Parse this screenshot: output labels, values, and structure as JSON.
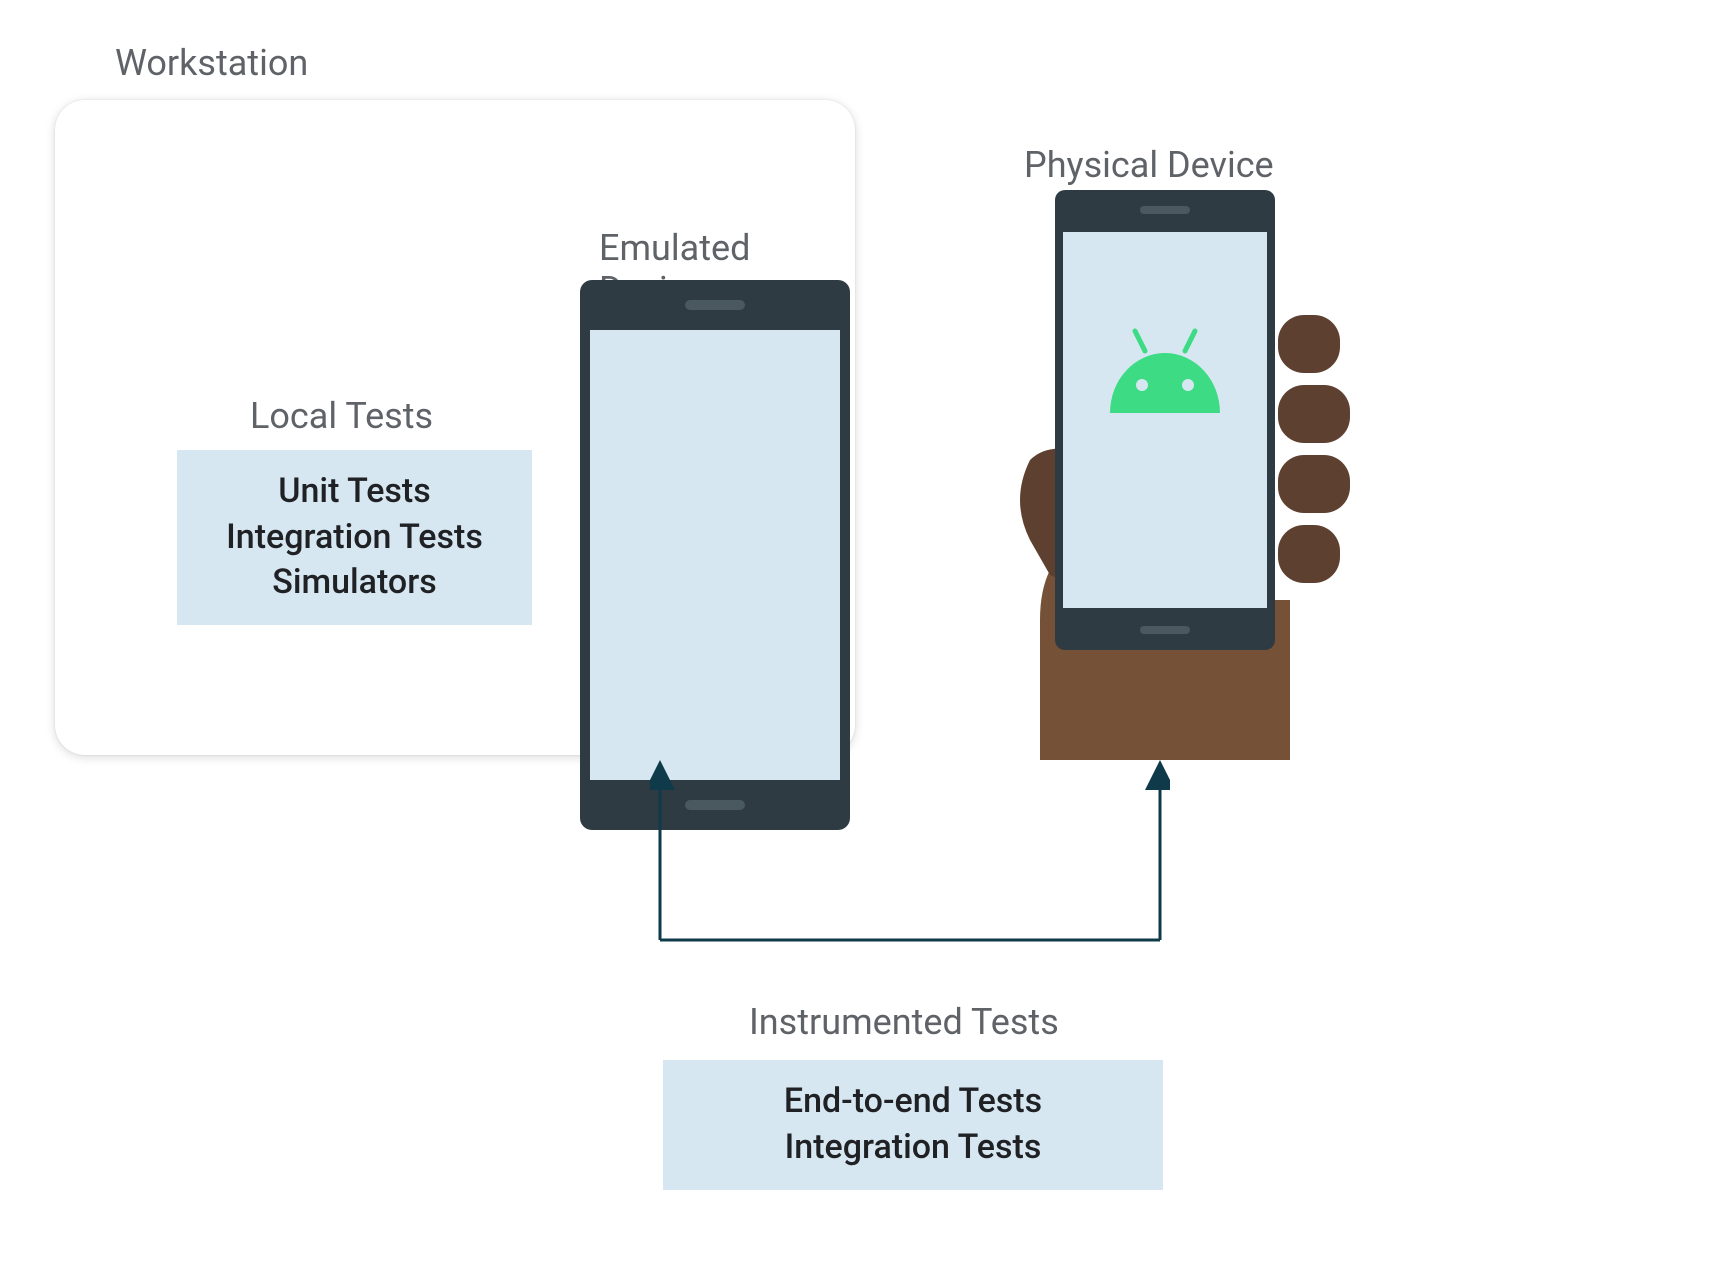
{
  "workstation": {
    "label": "Workstation"
  },
  "local_tests": {
    "label": "Local Tests",
    "items": {
      "line1": "Unit Tests",
      "line2": "Integration Tests",
      "line3": "Simulators"
    }
  },
  "emulated": {
    "label": "Emulated Device"
  },
  "physical": {
    "label": "Physical Device"
  },
  "instrumented": {
    "label": "Instrumented Tests",
    "items": {
      "line1": "End-to-end Tests",
      "line2": "Integration Tests"
    }
  },
  "colors": {
    "text_gray": "#5f6368",
    "text_dark": "#202124",
    "box_bg": "#d6e7f2",
    "phone_body": "#2f3b42",
    "android_green": "#3ddc84",
    "hand_dark": "#5e4030",
    "hand_light": "#755138",
    "connector": "#0f3a4a"
  }
}
